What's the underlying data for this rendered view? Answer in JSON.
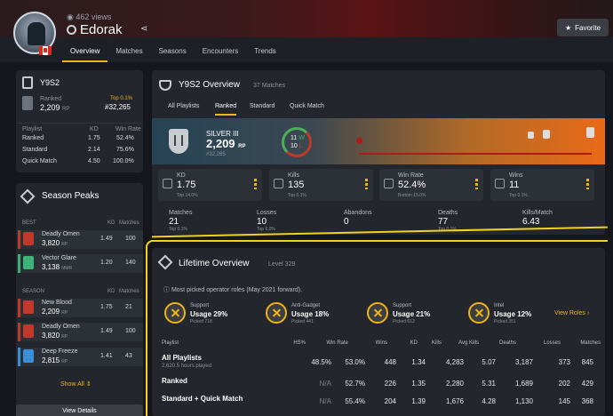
{
  "profile": {
    "views": "462 views",
    "username": "Edorak",
    "favorite_label": "Favorite"
  },
  "tabs": [
    "Overview",
    "Matches",
    "Seasons",
    "Encounters",
    "Trends"
  ],
  "season_card": {
    "title": "Y9S2",
    "rank_label": "Ranked",
    "rp": "2,209",
    "rp_unit": "RP",
    "top": "Top 0.1%",
    "position": "#32,265",
    "table_headers": [
      "Playlist",
      "KD",
      "Win Rate"
    ],
    "rows": [
      {
        "name": "Ranked",
        "kd": "1.75",
        "wr": "52.4%"
      },
      {
        "name": "Standard",
        "kd": "2.14",
        "wr": "75.6%"
      },
      {
        "name": "Quick Match",
        "kd": "4.50",
        "wr": "100.0%"
      }
    ]
  },
  "season_peaks": {
    "title": "Season Peaks",
    "best_label": "BEST",
    "season_label": "SEASON",
    "kd_header": "KD",
    "matches_header": "Matches",
    "best": [
      {
        "name": "Deadly Omen",
        "rp": "3,820",
        "unit": "RP",
        "kd": "1.49",
        "matches": "100",
        "color": "#c0392b"
      },
      {
        "name": "Vector Glare",
        "rp": "3,138",
        "unit": "MMR",
        "kd": "1.20",
        "matches": "140",
        "color": "#3fb47a"
      }
    ],
    "season": [
      {
        "name": "New Blood",
        "rp": "2,209",
        "unit": "RP",
        "kd": "1.75",
        "matches": "21",
        "color": "#c0392b"
      },
      {
        "name": "Deadly Omen",
        "rp": "3,820",
        "unit": "RP",
        "kd": "1.49",
        "matches": "100",
        "color": "#c0392b"
      },
      {
        "name": "Deep Freeze",
        "rp": "2,815",
        "unit": "RP",
        "kd": "1.41",
        "matches": "43",
        "color": "#3a8ed8"
      }
    ],
    "show_all": "Show All",
    "view_details": "View Details"
  },
  "overview": {
    "title": "Y9S2 Overview",
    "matches": "37 Matches",
    "tabs": [
      "All Playlists",
      "Ranked",
      "Standard",
      "Quick Match"
    ],
    "rank_name": "SILVER III",
    "rp": "2,209",
    "rp_unit": "RP",
    "position": "#32,265",
    "wins": "11",
    "wins_label": "W",
    "losses": "10",
    "losses_label": "L",
    "stats": [
      {
        "label": "KD",
        "value": "1.75",
        "top": "Top 14.0%"
      },
      {
        "label": "Kills",
        "value": "135",
        "top": "Top 0.1%"
      },
      {
        "label": "Win Rate",
        "value": "52.4%",
        "top": "Bottom 15.0%"
      },
      {
        "label": "Wins",
        "value": "11",
        "top": "Top 0.1%"
      }
    ],
    "substats": [
      {
        "label": "Matches",
        "value": "21",
        "top": "Top 0.1%"
      },
      {
        "label": "Losses",
        "value": "10",
        "top": "Top 6.0%"
      },
      {
        "label": "Abandons",
        "value": "0",
        "top": ""
      },
      {
        "label": "Deaths",
        "value": "77",
        "top": "Top 0.1%"
      },
      {
        "label": "Kills/Match",
        "value": "6.43",
        "top": ""
      }
    ]
  },
  "lifetime": {
    "title": "Lifetime Overview",
    "level": "Level 329",
    "note": "Most picked operator roles (May 2021 forward).",
    "roles": [
      {
        "name": "Support",
        "usage": "Usage 29%",
        "picked": "Picked 718"
      },
      {
        "name": "Anti-Gadget",
        "usage": "Usage 18%",
        "picked": "Picked 441"
      },
      {
        "name": "Support",
        "usage": "Usage 21%",
        "picked": "Picked 612"
      },
      {
        "name": "Intel",
        "usage": "Usage 12%",
        "picked": "Picked 351"
      }
    ],
    "view_roles": "View Roles",
    "headers": [
      "Playlist",
      "HS%",
      "Win Rate",
      "Wins",
      "KD",
      "Kills",
      "Avg Kills",
      "Deaths",
      "Losses",
      "Matches"
    ],
    "rows": [
      {
        "name": "All Playlists",
        "sub": "2,620.5 hours played",
        "cells": [
          "48.5%",
          "53.0%",
          "448",
          "1.34",
          "4,283",
          "5.07",
          "3,187",
          "373",
          "845"
        ]
      },
      {
        "name": "Ranked",
        "sub": "",
        "cells": [
          "N/A",
          "52.7%",
          "226",
          "1.35",
          "2,280",
          "5.31",
          "1,689",
          "202",
          "429"
        ]
      },
      {
        "name": "Standard + Quick Match",
        "sub": "",
        "cells": [
          "N/A",
          "55.4%",
          "204",
          "1.39",
          "1,676",
          "4.28",
          "1,130",
          "145",
          "368"
        ]
      }
    ]
  }
}
